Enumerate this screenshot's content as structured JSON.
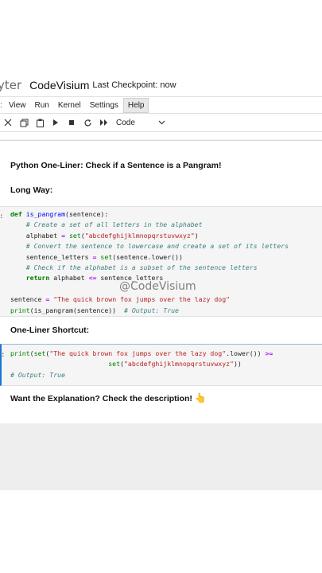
{
  "header": {
    "logo_fragment": "yter",
    "notebook_title": "CodeVisium",
    "checkpoint": "Last Checkpoint: now"
  },
  "menu": {
    "items": [
      "View",
      "Run",
      "Kernel",
      "Settings",
      "Help"
    ],
    "active": "Help"
  },
  "toolbar": {
    "icons": [
      "cut-icon",
      "copy-icon",
      "paste-icon",
      "run-icon",
      "stop-icon",
      "restart-icon",
      "fast-forward-icon"
    ],
    "cell_type": "Code"
  },
  "cells": {
    "title": "Python One-Liner: Check if a Sentence is a Pangram!",
    "long_way": "Long Way:",
    "long_code": {
      "l1_def": "def",
      "l1_fn": "is_pangram",
      "l1_rest": "(sentence):",
      "l2": "    # Create a set of all letters in the alphabet",
      "l3_a": "    alphabet ",
      "l3_eq": "=",
      "l3_set": "set",
      "l3_str": "\"abcdefghijklmnopqrstuvwxyz\"",
      "l4": "    # Convert the sentence to lowercase and create a set of its letters",
      "l5_a": "    sentence_letters ",
      "l5_b": "(sentence.lower())",
      "l6": "    # Check if the alphabet is a subset of the sentence letters",
      "l7_ret": "return",
      "l7_a": " alphabet ",
      "l7_op": "<=",
      "l7_b": " sentence_letters",
      "l8_a": "sentence ",
      "l8_str": "\"The quick brown fox jumps over the lazy dog\"",
      "l9_print": "print",
      "l9_a": "(is_pangram(sentence))  ",
      "l9_com": "# Output: True"
    },
    "watermark": "@CodeVisium",
    "shortcut_label": "One-Liner Shortcut:",
    "short_code": {
      "l1_print": "print",
      "l1_set": "set",
      "l1_str": "\"The quick brown fox jumps over the lazy dog\"",
      "l1_rest": ".lower()) ",
      "l1_op": ">=",
      "l2_set": "set",
      "l2_str": "\"abcdefghijklmnopqrstuvwxyz\"",
      "l2_rest": "))",
      "l3": "# Output: True"
    },
    "explanation": "Want the Explanation? Check the description!",
    "emoji": "👆"
  },
  "colors": {
    "keyword": "#008000",
    "function": "#0000ff",
    "string": "#ba2121",
    "comment": "#408080",
    "operator": "#aa22ff",
    "active_cell": "#1976d2"
  }
}
